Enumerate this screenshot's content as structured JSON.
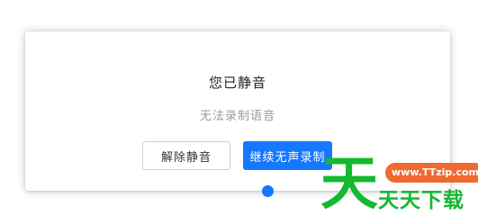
{
  "dialog": {
    "title": "您已静音",
    "subtitle": "无法录制语音",
    "unmute_label": "解除静音",
    "continue_label": "继续无声录制"
  },
  "watermark": {
    "big_char": "天",
    "url": "www.TTzip.com",
    "text": "天天下载"
  },
  "colors": {
    "primary": "#1677ff",
    "watermark_green": "#13b92f",
    "watermark_orange": "#ef6a30"
  }
}
